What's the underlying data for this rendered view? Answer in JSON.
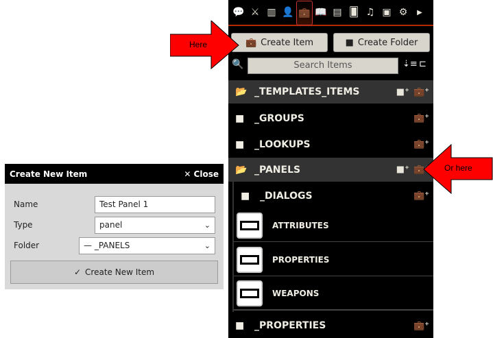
{
  "sidebar": {
    "tabs": [
      {
        "icon": "chat-icon"
      },
      {
        "icon": "crossed-swords-icon"
      },
      {
        "icon": "map-icon"
      },
      {
        "icon": "actor-icon"
      },
      {
        "icon": "suitcase-icon",
        "active": true
      },
      {
        "icon": "journal-icon"
      },
      {
        "icon": "table-icon"
      },
      {
        "icon": "cards-icon"
      },
      {
        "icon": "music-icon"
      },
      {
        "icon": "compendium-icon"
      },
      {
        "icon": "settings-icon"
      },
      {
        "icon": "expand-arrow-icon"
      }
    ],
    "create_item": "Create Item",
    "create_folder": "Create Folder",
    "search_placeholder": "Search Items",
    "folders": {
      "templates": "_TEMPLATES_ITEMS",
      "groups": "_GROUPS",
      "lookups": "_LOOKUPS",
      "panels": "_PANELS",
      "dialogs": "_DIALOGS",
      "properties": "_PROPERTIES"
    },
    "items": [
      "ATTRIBUTES",
      "PROPERTIES",
      "WEAPONS"
    ]
  },
  "dialog": {
    "title": "Create New Item",
    "close": "Close",
    "name_label": "Name",
    "name_value": "Test Panel 1",
    "type_label": "Type",
    "type_value": "panel",
    "folder_label": "Folder",
    "folder_value": "— _PANELS",
    "submit": "Create New Item"
  },
  "annotations": {
    "here": "Here",
    "or_here": "Or here",
    "arrow_color": "#ff0000"
  }
}
